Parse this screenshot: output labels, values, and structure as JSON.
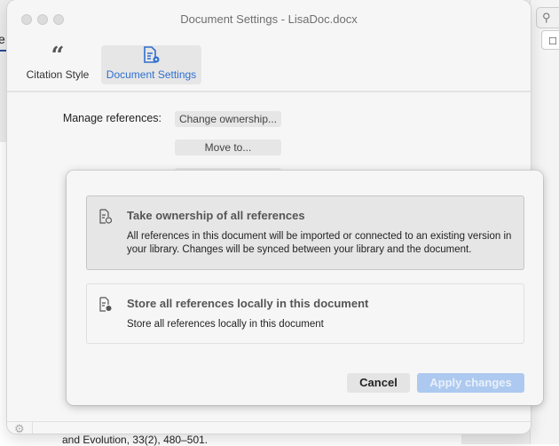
{
  "background": {
    "tab_fragment": "e",
    "text_fragment": "and Evolution, 33(2), 480–501."
  },
  "window": {
    "title": "Document Settings - LisaDoc.docx"
  },
  "tabs": [
    {
      "label": "Citation Style",
      "icon": "quote-icon"
    },
    {
      "label": "Document Settings",
      "icon": "document-gear-icon",
      "active": true
    }
  ],
  "settings": {
    "manage_label": "Manage references:",
    "buttons": [
      "Change ownership...",
      "Move to..."
    ]
  },
  "modal": {
    "options": [
      {
        "title": "Take ownership of all references",
        "description": "All references in this document will be imported or connected to an existing version in your library. Changes will be synced between your library and the document.",
        "icon": "document-sync-icon",
        "selected": true
      },
      {
        "title": "Store all references locally in this document",
        "description": "Store all references locally in this document",
        "icon": "document-dot-icon"
      }
    ],
    "cancel_label": "Cancel",
    "apply_label": "Apply changes"
  },
  "colors": {
    "accent": "#2f6fcf",
    "apply_disabled": "#adc9ef"
  }
}
